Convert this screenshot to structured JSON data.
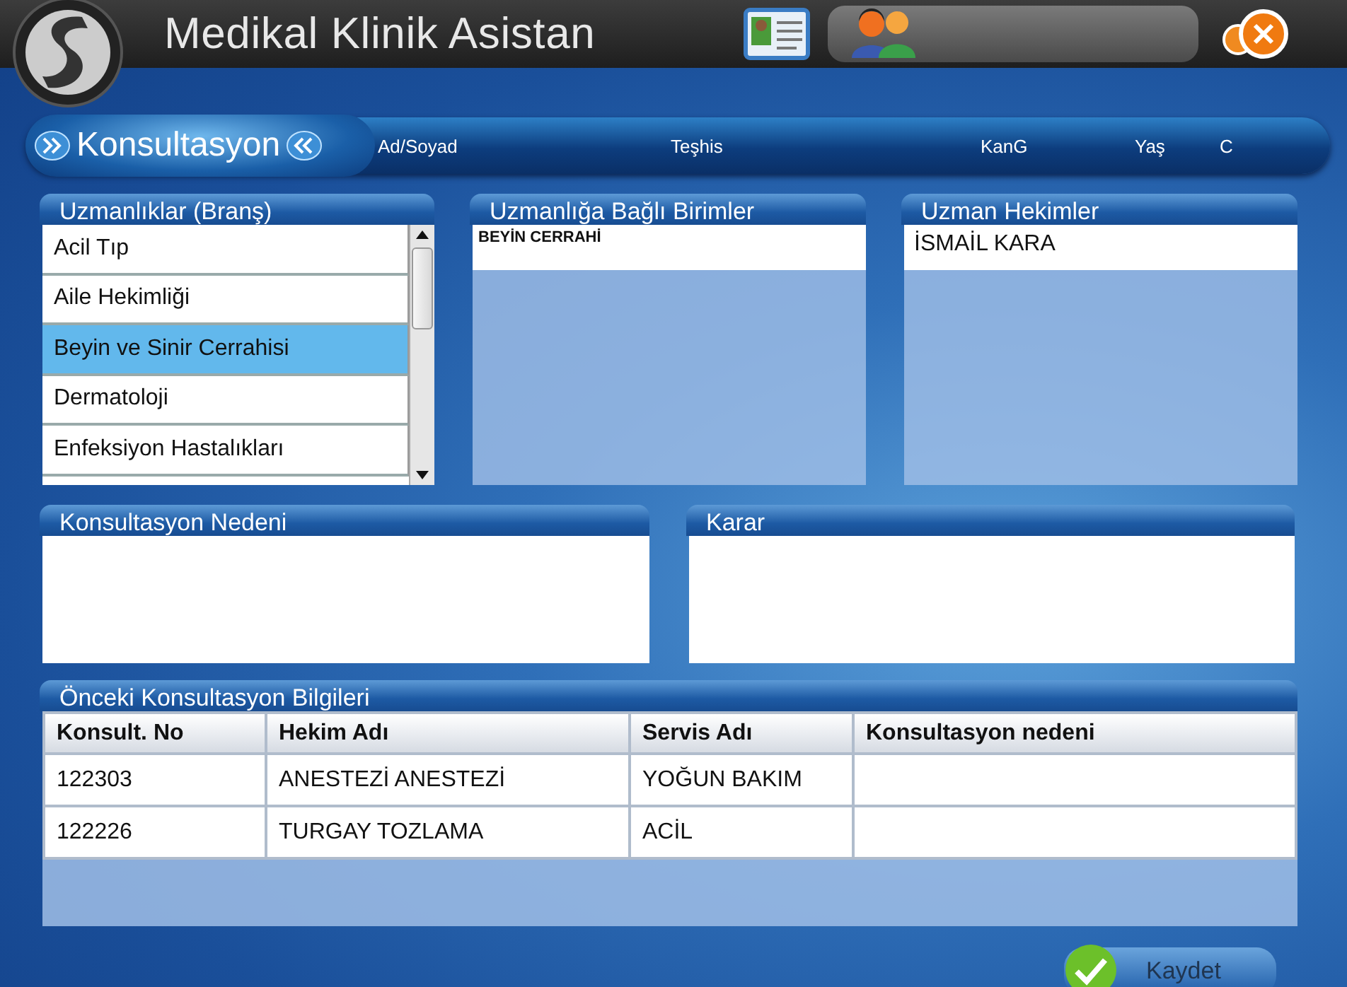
{
  "app": {
    "title": "Medikal Klinik Asistan"
  },
  "module_bar": {
    "title": "Konsultasyon",
    "fields": [
      "Ad/Soyad",
      "Teşhis",
      "KanG",
      "Yaş",
      "C"
    ]
  },
  "specialties": {
    "title": "Uzmanlıklar (Branş)",
    "items": [
      {
        "label": "Acil Tıp",
        "selected": false
      },
      {
        "label": "Aile Hekimliği",
        "selected": false
      },
      {
        "label": "Beyin ve Sinir Cerrahisi",
        "selected": true
      },
      {
        "label": "Dermatoloji",
        "selected": false
      },
      {
        "label": "Enfeksiyon Hastalıkları",
        "selected": false
      }
    ]
  },
  "units": {
    "title": "Uzmanlığa Bağlı Birimler",
    "items": [
      "BEYİN CERRAHİ"
    ]
  },
  "doctors": {
    "title": "Uzman Hekimler",
    "items": [
      "İSMAİL KARA"
    ]
  },
  "reason": {
    "title": "Konsultasyon Nedeni"
  },
  "decision": {
    "title": "Karar"
  },
  "history": {
    "title": "Önceki Konsultasyon Bilgileri",
    "columns": [
      "Konsult. No",
      "Hekim Adı",
      "Servis Adı",
      "Konsultasyon nedeni"
    ],
    "rows": [
      {
        "no": "122303",
        "doctor": "ANESTEZİ ANESTEZİ",
        "service": "YOĞUN BAKIM"
      },
      {
        "no": "122226",
        "doctor": "TURGAY TOZLAMA",
        "service": "ACİL"
      }
    ]
  },
  "save_button": "Kaydet"
}
